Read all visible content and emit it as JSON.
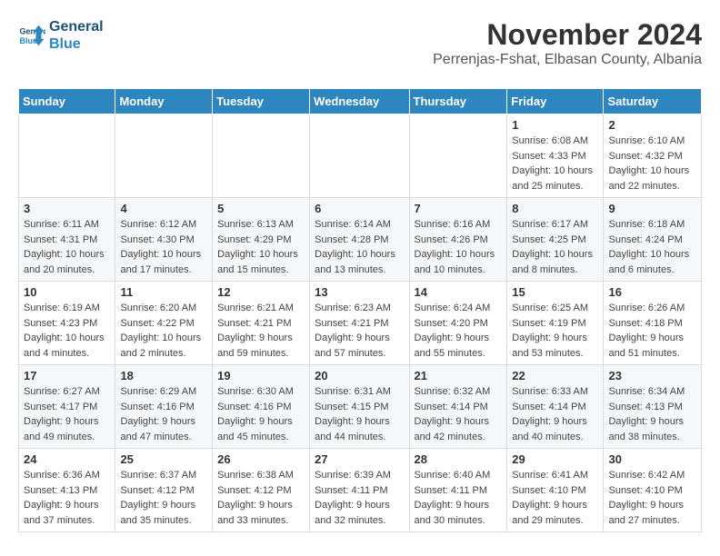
{
  "app": {
    "logo_line1": "General",
    "logo_line2": "Blue"
  },
  "header": {
    "month_year": "November 2024",
    "location": "Perrenjas-Fshat, Elbasan County, Albania"
  },
  "weekdays": [
    "Sunday",
    "Monday",
    "Tuesday",
    "Wednesday",
    "Thursday",
    "Friday",
    "Saturday"
  ],
  "weeks": [
    [
      {
        "day": "",
        "info": ""
      },
      {
        "day": "",
        "info": ""
      },
      {
        "day": "",
        "info": ""
      },
      {
        "day": "",
        "info": ""
      },
      {
        "day": "",
        "info": ""
      },
      {
        "day": "1",
        "info": "Sunrise: 6:08 AM\nSunset: 4:33 PM\nDaylight: 10 hours and 25 minutes."
      },
      {
        "day": "2",
        "info": "Sunrise: 6:10 AM\nSunset: 4:32 PM\nDaylight: 10 hours and 22 minutes."
      }
    ],
    [
      {
        "day": "3",
        "info": "Sunrise: 6:11 AM\nSunset: 4:31 PM\nDaylight: 10 hours and 20 minutes."
      },
      {
        "day": "4",
        "info": "Sunrise: 6:12 AM\nSunset: 4:30 PM\nDaylight: 10 hours and 17 minutes."
      },
      {
        "day": "5",
        "info": "Sunrise: 6:13 AM\nSunset: 4:29 PM\nDaylight: 10 hours and 15 minutes."
      },
      {
        "day": "6",
        "info": "Sunrise: 6:14 AM\nSunset: 4:28 PM\nDaylight: 10 hours and 13 minutes."
      },
      {
        "day": "7",
        "info": "Sunrise: 6:16 AM\nSunset: 4:26 PM\nDaylight: 10 hours and 10 minutes."
      },
      {
        "day": "8",
        "info": "Sunrise: 6:17 AM\nSunset: 4:25 PM\nDaylight: 10 hours and 8 minutes."
      },
      {
        "day": "9",
        "info": "Sunrise: 6:18 AM\nSunset: 4:24 PM\nDaylight: 10 hours and 6 minutes."
      }
    ],
    [
      {
        "day": "10",
        "info": "Sunrise: 6:19 AM\nSunset: 4:23 PM\nDaylight: 10 hours and 4 minutes."
      },
      {
        "day": "11",
        "info": "Sunrise: 6:20 AM\nSunset: 4:22 PM\nDaylight: 10 hours and 2 minutes."
      },
      {
        "day": "12",
        "info": "Sunrise: 6:21 AM\nSunset: 4:21 PM\nDaylight: 9 hours and 59 minutes."
      },
      {
        "day": "13",
        "info": "Sunrise: 6:23 AM\nSunset: 4:21 PM\nDaylight: 9 hours and 57 minutes."
      },
      {
        "day": "14",
        "info": "Sunrise: 6:24 AM\nSunset: 4:20 PM\nDaylight: 9 hours and 55 minutes."
      },
      {
        "day": "15",
        "info": "Sunrise: 6:25 AM\nSunset: 4:19 PM\nDaylight: 9 hours and 53 minutes."
      },
      {
        "day": "16",
        "info": "Sunrise: 6:26 AM\nSunset: 4:18 PM\nDaylight: 9 hours and 51 minutes."
      }
    ],
    [
      {
        "day": "17",
        "info": "Sunrise: 6:27 AM\nSunset: 4:17 PM\nDaylight: 9 hours and 49 minutes."
      },
      {
        "day": "18",
        "info": "Sunrise: 6:29 AM\nSunset: 4:16 PM\nDaylight: 9 hours and 47 minutes."
      },
      {
        "day": "19",
        "info": "Sunrise: 6:30 AM\nSunset: 4:16 PM\nDaylight: 9 hours and 45 minutes."
      },
      {
        "day": "20",
        "info": "Sunrise: 6:31 AM\nSunset: 4:15 PM\nDaylight: 9 hours and 44 minutes."
      },
      {
        "day": "21",
        "info": "Sunrise: 6:32 AM\nSunset: 4:14 PM\nDaylight: 9 hours and 42 minutes."
      },
      {
        "day": "22",
        "info": "Sunrise: 6:33 AM\nSunset: 4:14 PM\nDaylight: 9 hours and 40 minutes."
      },
      {
        "day": "23",
        "info": "Sunrise: 6:34 AM\nSunset: 4:13 PM\nDaylight: 9 hours and 38 minutes."
      }
    ],
    [
      {
        "day": "24",
        "info": "Sunrise: 6:36 AM\nSunset: 4:13 PM\nDaylight: 9 hours and 37 minutes."
      },
      {
        "day": "25",
        "info": "Sunrise: 6:37 AM\nSunset: 4:12 PM\nDaylight: 9 hours and 35 minutes."
      },
      {
        "day": "26",
        "info": "Sunrise: 6:38 AM\nSunset: 4:12 PM\nDaylight: 9 hours and 33 minutes."
      },
      {
        "day": "27",
        "info": "Sunrise: 6:39 AM\nSunset: 4:11 PM\nDaylight: 9 hours and 32 minutes."
      },
      {
        "day": "28",
        "info": "Sunrise: 6:40 AM\nSunset: 4:11 PM\nDaylight: 9 hours and 30 minutes."
      },
      {
        "day": "29",
        "info": "Sunrise: 6:41 AM\nSunset: 4:10 PM\nDaylight: 9 hours and 29 minutes."
      },
      {
        "day": "30",
        "info": "Sunrise: 6:42 AM\nSunset: 4:10 PM\nDaylight: 9 hours and 27 minutes."
      }
    ]
  ]
}
